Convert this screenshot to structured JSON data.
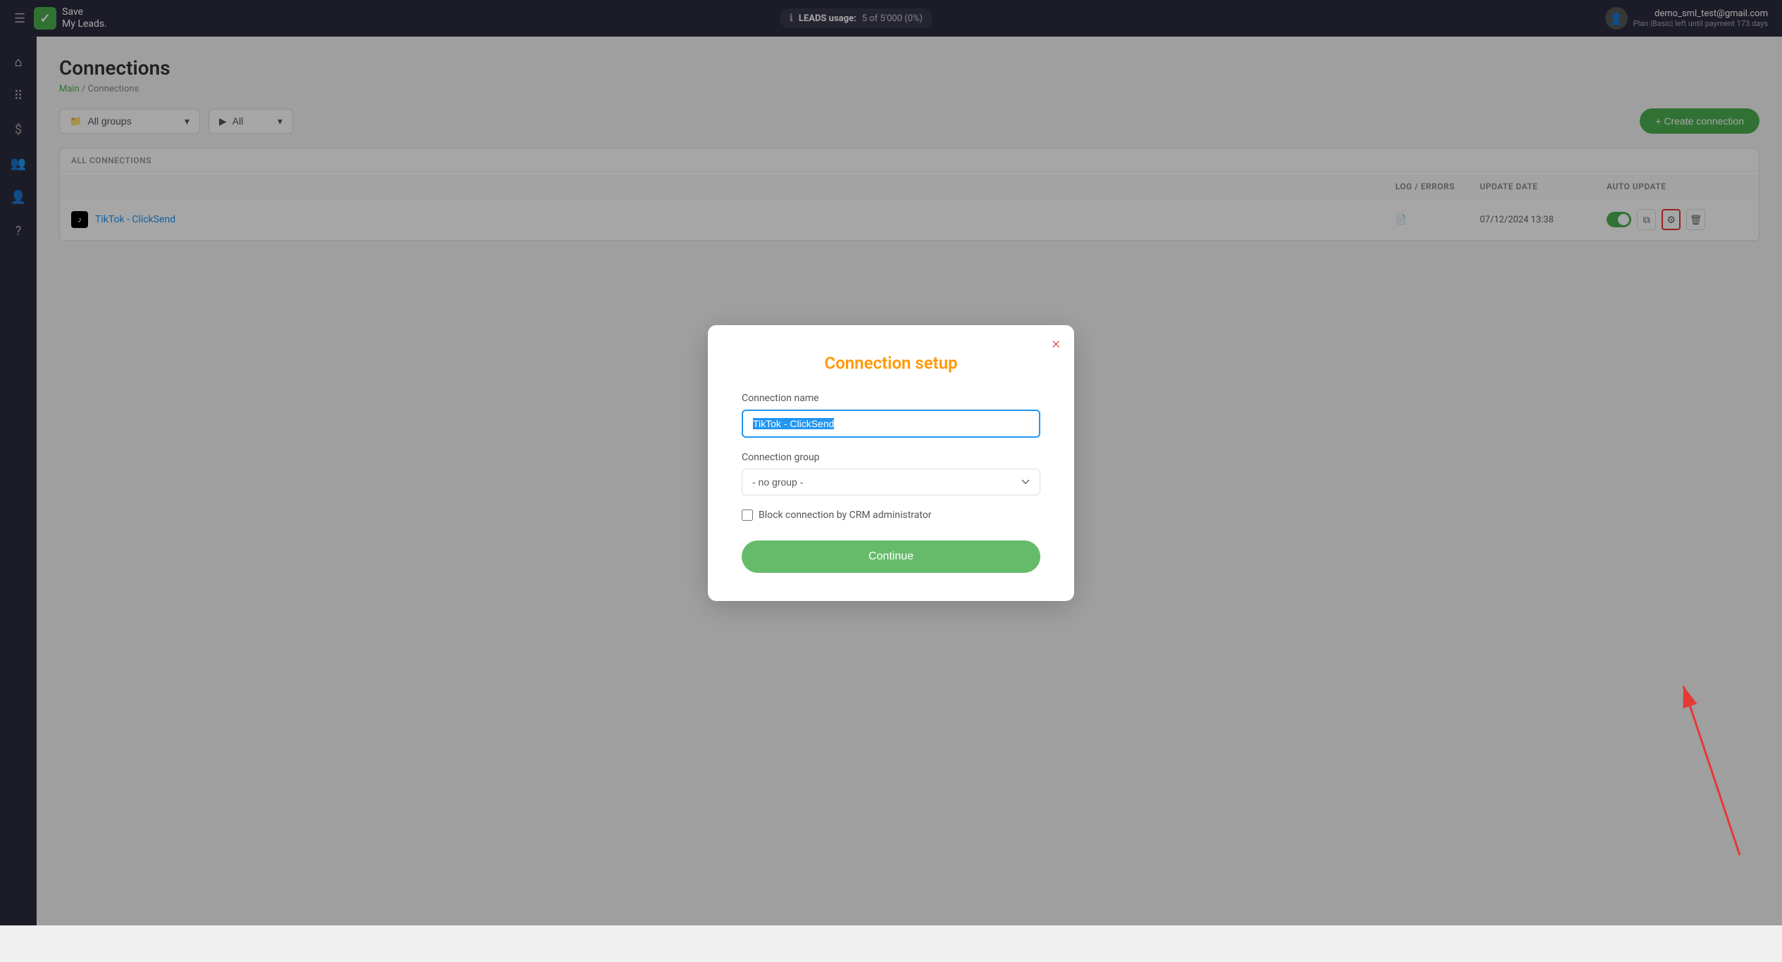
{
  "header": {
    "menu_icon": "☰",
    "logo_text_line1": "Save",
    "logo_text_line2": "My Leads.",
    "leads_label": "LEADS usage:",
    "leads_count": "5 of 5'000 (0%)",
    "user_email": "demo_sml_test@gmail.com",
    "user_plan": "Plan |Basic| left until payment 173 days"
  },
  "sidebar": {
    "items": [
      {
        "icon": "⌂",
        "name": "home"
      },
      {
        "icon": "⠿",
        "name": "integrations"
      },
      {
        "icon": "$",
        "name": "billing"
      },
      {
        "icon": "👥",
        "name": "users"
      },
      {
        "icon": "👤",
        "name": "account"
      },
      {
        "icon": "?",
        "name": "help"
      }
    ]
  },
  "page": {
    "title": "Connections",
    "breadcrumb_main": "Main",
    "breadcrumb_separator": " / ",
    "breadcrumb_current": "Connections"
  },
  "toolbar": {
    "group_dropdown_label": "All groups",
    "group_dropdown_icon": "📁",
    "status_dropdown_label": "All",
    "create_button_label": "+ Create connection"
  },
  "table": {
    "section_label": "ALL CONNECTIONS",
    "columns": [
      "",
      "LOG / ERRORS",
      "UPDATE DATE",
      "AUTO UPDATE",
      ""
    ],
    "rows": [
      {
        "name": "TikTok - ClickSend",
        "log_errors": "",
        "update_date": "07/12/2024 13:38",
        "auto_update_enabled": true
      }
    ]
  },
  "modal": {
    "title": "Connection setup",
    "close_label": "×",
    "connection_name_label": "Connection name",
    "connection_name_value": "TikTok - ClickSend",
    "connection_group_label": "Connection group",
    "connection_group_value": "- no group -",
    "block_checkbox_label": "Block connection by CRM administrator",
    "continue_button_label": "Continue"
  }
}
